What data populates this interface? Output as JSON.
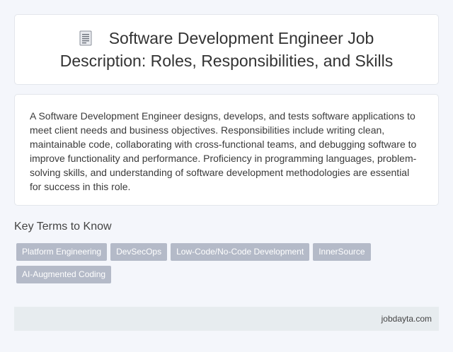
{
  "header": {
    "title": "Software Development Engineer Job Description: Roles, Responsibilities, and Skills",
    "icon": "document-icon"
  },
  "main": {
    "description": "A Software Development Engineer designs, develops, and tests software applications to meet client needs and business objectives. Responsibilities include writing clean, maintainable code, collaborating with cross-functional teams, and debugging software to improve functionality and performance. Proficiency in programming languages, problem-solving skills, and understanding of software development methodologies are essential for success in this role."
  },
  "key_terms": {
    "heading": "Key Terms to Know",
    "tags": [
      "Platform Engineering",
      "DevSecOps",
      "Low-Code/No-Code Development",
      "InnerSource",
      "AI-Augmented Coding"
    ]
  },
  "footer": {
    "site": "jobdayta.com"
  },
  "colors": {
    "background": "#f4f6fb",
    "card": "#ffffff",
    "tag": "#b4bac8",
    "footer": "#e7ecef"
  }
}
